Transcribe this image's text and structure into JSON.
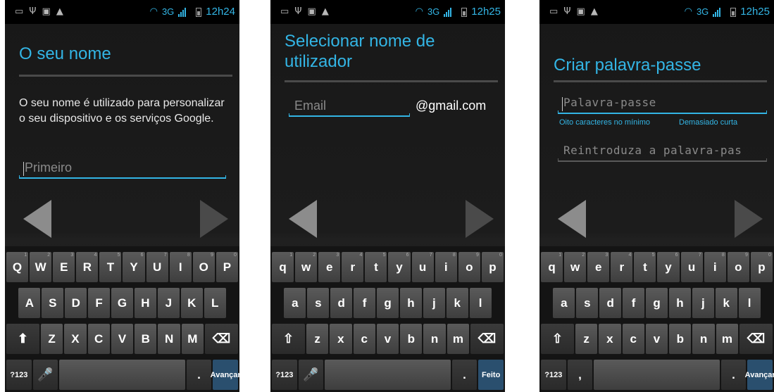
{
  "status_bar": {
    "network": "3G",
    "times": [
      "12h24",
      "12h25",
      "12h25"
    ]
  },
  "screen1": {
    "title": "O seu nome",
    "description": "O seu nome é utilizado para personalizar o seu dispositivo e os serviços Google.",
    "first_name_placeholder": "Primeiro",
    "keyboard_mode": "uppercase",
    "action_label": "Avançar"
  },
  "screen2": {
    "title": "Selecionar nome de utilizador",
    "email_placeholder": "Email",
    "email_suffix": "@gmail.com",
    "keyboard_mode": "lowercase",
    "action_label": "Feito"
  },
  "screen3": {
    "title": "Criar palavra-passe",
    "password_placeholder": "Palavra-passe",
    "hint_min": "Oito caracteres no mínimo",
    "hint_strength": "Demasiado curta",
    "confirm_placeholder": "Reintroduza a palavra-pas",
    "keyboard_mode": "lowercase",
    "action_label": "Avançar"
  },
  "keyboard": {
    "row1": [
      "q",
      "w",
      "e",
      "r",
      "t",
      "y",
      "u",
      "i",
      "o",
      "p"
    ],
    "row1_numbers": [
      "1",
      "2",
      "3",
      "4",
      "5",
      "6",
      "7",
      "8",
      "9",
      "0"
    ],
    "row2": [
      "a",
      "s",
      "d",
      "f",
      "g",
      "h",
      "j",
      "k",
      "l"
    ],
    "row3": [
      "z",
      "x",
      "c",
      "v",
      "b",
      "n",
      "m"
    ],
    "symbols_key": "?123",
    "period_key": ".",
    "comma_key": ","
  },
  "colors": {
    "accent": "#33b5e5",
    "background": "#1a1a1a",
    "action_key": "#2a4f6e"
  },
  "icons": [
    "usb-debug-icon",
    "usb-icon",
    "image-icon",
    "warning-icon",
    "wifi-icon",
    "signal-icon",
    "battery-icon",
    "back-arrow-icon",
    "next-arrow-icon",
    "shift-icon",
    "backspace-icon",
    "microphone-icon"
  ]
}
